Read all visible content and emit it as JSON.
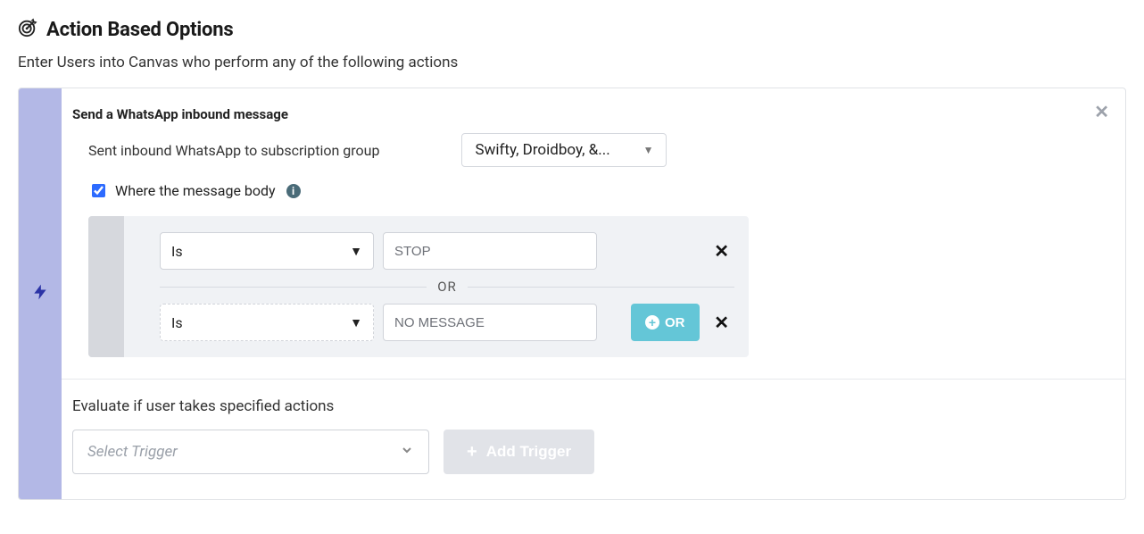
{
  "header": {
    "title": "Action Based Options",
    "subtitle": "Enter Users into Canvas who perform any of the following actions"
  },
  "card": {
    "title": "Send a WhatsApp inbound message",
    "subscriptionRow": {
      "label": "Sent inbound WhatsApp to subscription group",
      "selectedValue": "Swifty, Droidboy, &..."
    },
    "bodyFilter": {
      "checkboxLabel": "Where the message body",
      "checked": true
    },
    "conditions": {
      "dividerLabel": "OR",
      "rows": [
        {
          "operator": "Is",
          "value": "STOP",
          "dashed": false
        },
        {
          "operator": "Is",
          "value": "NO MESSAGE",
          "dashed": true
        }
      ],
      "orButton": "OR"
    }
  },
  "evaluate": {
    "label": "Evaluate if user takes specified actions",
    "triggerPlaceholder": "Select Trigger",
    "addTriggerLabel": "Add Trigger"
  }
}
